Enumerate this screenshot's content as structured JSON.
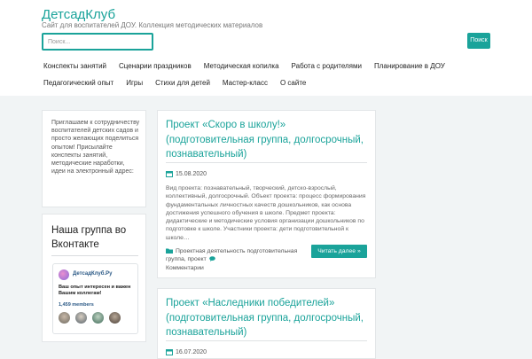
{
  "site": {
    "title": "ДетсадКлуб",
    "description": "Сайт для воспитателей ДОУ. Коллекция методических материалов"
  },
  "search": {
    "placeholder": "Поиск...",
    "button_label": "Поиск"
  },
  "nav": {
    "row1": [
      "Конспекты занятий",
      "Сценарии праздников",
      "Методическая копилка",
      "Работа с родителями",
      "Планирование в ДОУ"
    ],
    "row2": [
      "Педагогический опыт",
      "Игры",
      "Стихи для детей",
      "Мастер-класс",
      "О сайте"
    ]
  },
  "sidebar": {
    "invite_text": "Приглашаем к сотрудничеству воспитателей детских садов и просто желающих поделиться опытом! Присылайте конспекты занятий, методические наработки, идеи на электронный адрес:",
    "vk_widget": {
      "title": "Наша группа во Вконтакте",
      "group_name": "ДетсадКлуб.Ру",
      "description": "Ваш опыт интересен и важен Вашим коллегам!",
      "members": "1,459 members"
    }
  },
  "posts": [
    {
      "title": "Проект «Скоро в школу!» (подготовительная группа, долгосрочный, познавательный)",
      "date": "15.08.2020",
      "excerpt": "Вид проекта: познавательный, творческий, детско-взрослый, коллективный, долгосрочный. Объект проекта: процесс формирования фундаментальных личностных качеств дошкольников, как основа достижения успешного обучения в школе. Предмет проекта: дидактические и методические условия организации дошкольников по подготовке к школе. Участники проекта: дети подготовительной к школе…",
      "category": "Проектная деятельность подготовительная группа, проект",
      "comments": "Комментарии",
      "read_more": "Читать далее »"
    },
    {
      "title": "Проект «Наследники победителей» (подготовительная группа, долгосрочный, познавательный)",
      "date": "16.07.2020"
    }
  ],
  "colors": {
    "accent": "#1aa39a",
    "background": "#f1f4f5"
  }
}
